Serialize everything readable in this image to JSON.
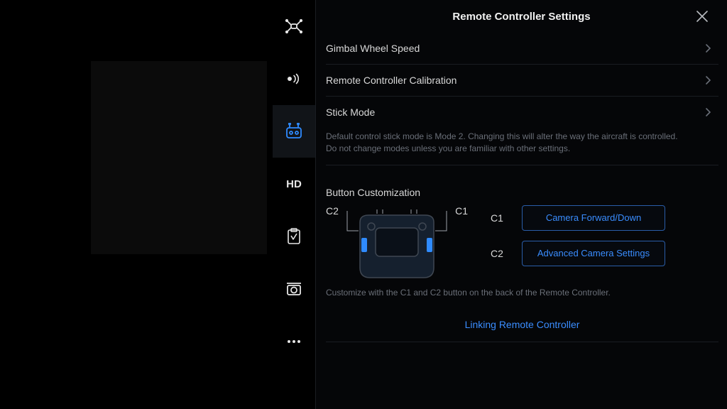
{
  "header": {
    "title": "Remote Controller Settings"
  },
  "rows": {
    "gimbal": {
      "label": "Gimbal Wheel Speed"
    },
    "calibration": {
      "label": "Remote Controller Calibration"
    },
    "stick": {
      "label": "Stick Mode",
      "desc": "Default control stick mode is Mode 2. Changing this will alter the way the aircraft is controlled. Do not change modes unless you are familiar with other settings."
    }
  },
  "customization": {
    "title": "Button Customization",
    "diagram": {
      "left": "C2",
      "right": "C1"
    },
    "c1": {
      "key": "C1",
      "value": "Camera Forward/Down"
    },
    "c2": {
      "key": "C2",
      "value": "Advanced Camera Settings"
    },
    "hint": "Customize with the C1 and C2 button on the back of the Remote Controller."
  },
  "link": {
    "label": "Linking Remote Controller"
  },
  "icons": {
    "hd": "HD"
  }
}
